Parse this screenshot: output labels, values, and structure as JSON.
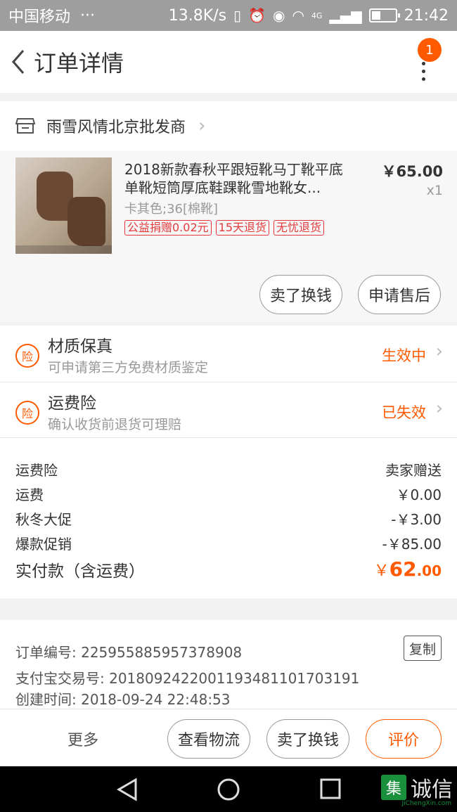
{
  "status_bar": {
    "carrier": "中国移动",
    "carrier_extra": "···",
    "net_speed": "13.8K/s",
    "network": "4G",
    "time": "21:42"
  },
  "header": {
    "title": "订单详情",
    "badge_count": "1"
  },
  "shop": {
    "name": "雨雪风情北京批发商"
  },
  "product": {
    "title": "2018新款春秋平跟短靴马丁靴平底单靴短筒厚底鞋踝靴雪地靴女...",
    "sku": "卡其色;36[棉靴]",
    "tags": [
      "公益捐赠0.02元",
      "15天退货",
      "无忧退货"
    ],
    "price": "￥65.00",
    "quantity": "x1",
    "sell_button": "卖了换钱",
    "after_sale_button": "申请售后"
  },
  "insurance": [
    {
      "icon_label": "险",
      "title": "材质保真",
      "desc": "可申请第三方免费材质鉴定",
      "status": "生效中"
    },
    {
      "icon_label": "险",
      "title": "运费险",
      "desc": "确认收货前退货可理赔",
      "status": "已失效"
    }
  ],
  "summary": {
    "rows": [
      {
        "label": "运费险",
        "value": "卖家赠送"
      },
      {
        "label": "运费",
        "value": "￥0.00"
      },
      {
        "label": "秋冬大促",
        "value": "-￥3.00"
      },
      {
        "label": "爆款促销",
        "value": "-￥85.00"
      }
    ],
    "total_label": "实付款（含运费）",
    "total_currency": "￥",
    "total_integer": "62",
    "total_decimal": ".00"
  },
  "order_info": {
    "order_no": "订单编号: 225955885957378908",
    "alipay_no": "支付宝交易号: 2018092422001193481101703191",
    "created": "创建时间: 2018-09-24 22:48:53",
    "copy_button": "复制"
  },
  "actions": {
    "more": "更多",
    "logistics": "查看物流",
    "sell": "卖了换钱",
    "review": "评价"
  },
  "watermark": {
    "logo": "集",
    "text": "诚信",
    "url": "JiChengXin.com"
  },
  "colors": {
    "accent": "#ff5a00",
    "tag_red": "#e4393c"
  }
}
